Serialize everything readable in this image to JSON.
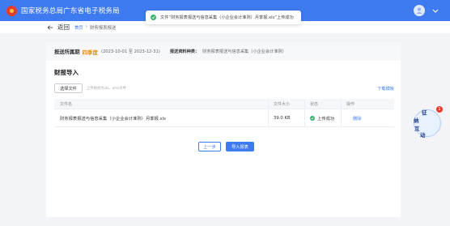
{
  "header": {
    "brand": "国家税务总局广东省电子税务局",
    "colors": {
      "primary": "#3e7bf0",
      "success": "#35b36b",
      "warning": "#f08c00",
      "logo": "#e43b2c"
    }
  },
  "toast": {
    "icon": "check-circle-icon",
    "message": "文件“财务报表报送与信息采集（小企业会计准则）月季报.xls”上传成功"
  },
  "nav": {
    "back_label": "返回",
    "breadcrumb": {
      "home": "首页",
      "sep": "›",
      "current": "财务报表报送"
    }
  },
  "period": {
    "label": "报送所属期",
    "season": "四季度",
    "range": "(2023-10-01 至 2023-12-31)",
    "type_label": "报送资料种类：",
    "type_value": "财务报表报送与信息采集（小企业会计准则）"
  },
  "upload": {
    "title": "财报导入",
    "choose_label": "选择文件",
    "hint": "上传格式为xls、xlsx文件",
    "template_link": "下载模板"
  },
  "table": {
    "headers": [
      "文件名",
      "文件大小",
      "状态",
      "操作"
    ],
    "rows": [
      {
        "name": "财务报表报送与信息采集（小企业会计准则）月季报.xls",
        "size": "39.0 KB",
        "status": "上传成功",
        "action": "删除"
      }
    ]
  },
  "actions": {
    "prev": "上一步",
    "import": "导入报表"
  },
  "assistant": {
    "badge": "1",
    "chars": [
      "征",
      "纳",
      "互",
      "动"
    ]
  }
}
